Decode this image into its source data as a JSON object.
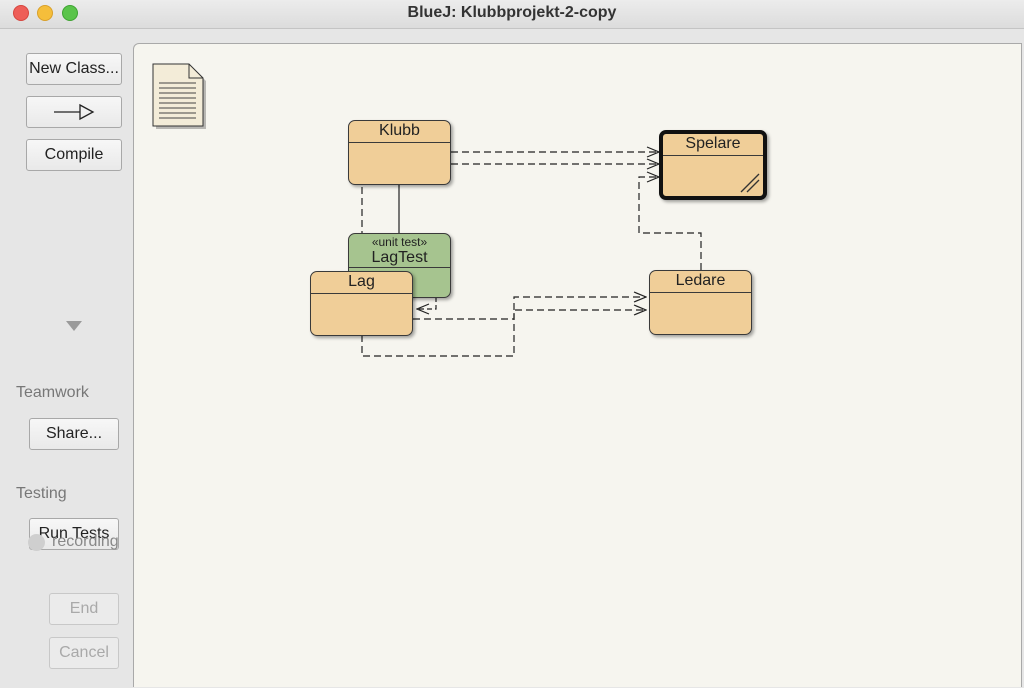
{
  "window": {
    "title": "BlueJ:  Klubbprojekt-2-copy"
  },
  "toolbar": {
    "new_class_label": "New Class...",
    "inheritance_arrow_icon": "inheritance-arrow-icon",
    "compile_label": "Compile"
  },
  "teamwork": {
    "label": "Teamwork",
    "share_label": "Share..."
  },
  "testing": {
    "label": "Testing",
    "run_tests_label": "Run Tests",
    "recording_label": "recording",
    "end_label": "End",
    "cancel_label": "Cancel"
  },
  "diagram": {
    "readme_icon": "document-icon",
    "classes": [
      {
        "name": "Klubb",
        "kind": "class",
        "color": "#f0ce98"
      },
      {
        "name": "Spelare",
        "kind": "class",
        "selected": true,
        "color": "#f0ce98"
      },
      {
        "name": "LagTest",
        "kind": "unit test",
        "stereotype": "«unit test»",
        "color": "#a6c48f"
      },
      {
        "name": "Lag",
        "kind": "class",
        "color": "#f0ce98"
      },
      {
        "name": "Ledare",
        "kind": "class",
        "color": "#f0ce98"
      }
    ]
  }
}
